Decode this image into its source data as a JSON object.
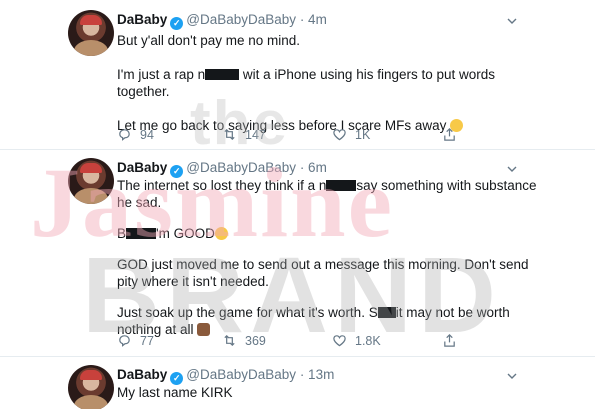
{
  "tweets": [
    {
      "name": "DaBaby",
      "handle": "@DaBabyDaBaby",
      "time": "· 4m",
      "lines": {
        "p1": "But y'all don't pay me no mind.",
        "p2a": "I'm just a rap n",
        "p2b": " wit a iPhone using his fingers to put words",
        "p2c": "together.",
        "p3": "Let me go back to saying less before I scare MFs away"
      },
      "replies": "94",
      "retweets": "147",
      "likes": "1K"
    },
    {
      "name": "DaBaby",
      "handle": "@DaBabyDaBaby",
      "time": "· 6m",
      "lines": {
        "p1a": "The internet so lost they think if a n",
        "p1b": "say something with substance",
        "p1c": "he sad.",
        "p2a": "B",
        "p2b": "'m GOOD",
        "p3a": "GOD just moved me to send out a message this morning. Don't send",
        "p3b": "pity where it isn't needed.",
        "p4a": "Just soak up the game for what it's worth. S",
        "p4b": "it may not be worth",
        "p4c": "nothing at all"
      },
      "replies": "77",
      "retweets": "369",
      "likes": "1.8K"
    },
    {
      "name": "DaBaby",
      "handle": "@DaBabyDaBaby",
      "time": "· 13m",
      "lines": {
        "p1": "My last name KIRK"
      }
    }
  ],
  "watermark": {
    "line1": "the",
    "line2": "Jasmine",
    "line3": "BRAND"
  },
  "icons": {
    "verified": "verified-badge-icon",
    "reply": "reply-icon",
    "retweet": "retweet-icon",
    "like": "like-icon",
    "share": "share-icon",
    "menu": "chevron-down-icon"
  },
  "colors": {
    "verified": "#1da1f2",
    "muted": "#657786",
    "text": "#14171a",
    "watermark_pink": "#f3a9b8",
    "watermark_gray": "#a8a8a8"
  }
}
